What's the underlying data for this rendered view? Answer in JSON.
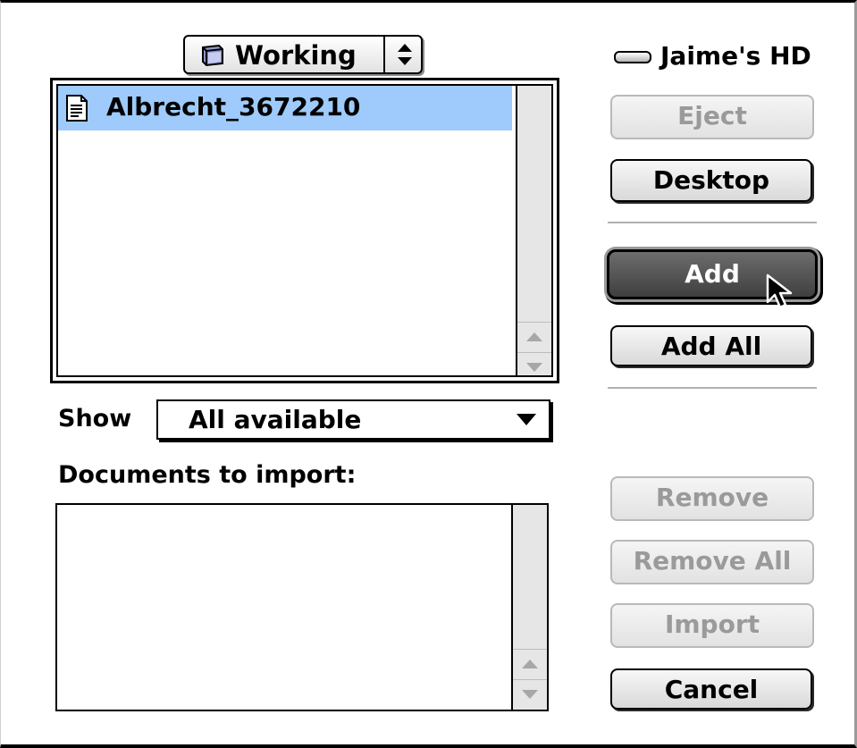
{
  "folder_popup": {
    "label": "Working",
    "icon": "folder-icon"
  },
  "file_list": {
    "items": [
      {
        "name": "Albrecht_3672210",
        "icon": "document-icon",
        "selected": true
      }
    ]
  },
  "show": {
    "label": "Show",
    "value": "All available"
  },
  "documents_to_import": {
    "label": "Documents to import:",
    "items": []
  },
  "volume": {
    "name": "Jaime's HD",
    "icon": "hard-drive-icon"
  },
  "buttons": {
    "eject": "Eject",
    "desktop": "Desktop",
    "add": "Add",
    "add_all": "Add All",
    "remove": "Remove",
    "remove_all": "Remove All",
    "import": "Import",
    "cancel": "Cancel"
  },
  "colors": {
    "selection": "#9ecbfb",
    "default_button": "#4f4f4f",
    "disabled_text": "#9a9a9a"
  }
}
